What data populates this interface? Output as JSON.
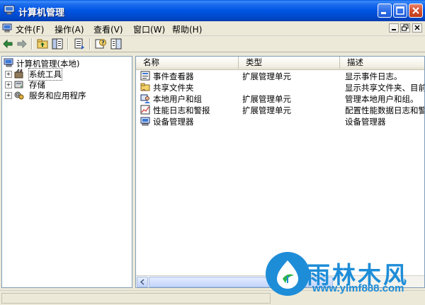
{
  "window": {
    "title": "计算机管理"
  },
  "menu": {
    "items": [
      "文件(F)",
      "操作(A)",
      "查看(V)",
      "窗口(W)",
      "帮助(H)"
    ]
  },
  "toolbar": {
    "icons": [
      "back-arrow-icon",
      "forward-arrow-icon",
      "up-folder-icon",
      "show-hide-tree-icon",
      "export-list-icon",
      "help-icon",
      "properties-icon"
    ]
  },
  "tree": {
    "root": "计算机管理(本地)",
    "children": [
      "系统工具",
      "存储",
      "服务和应用程序"
    ]
  },
  "list": {
    "columns": [
      "名称",
      "类型",
      "描述"
    ],
    "rows": [
      {
        "name": "事件查看器",
        "type": "扩展管理单元",
        "desc": "显示事件日志。"
      },
      {
        "name": "共享文件夹",
        "type": "",
        "desc": "显示共享文件夹、目前"
      },
      {
        "name": "本地用户和组",
        "type": "扩展管理单元",
        "desc": "管理本地用户和组。"
      },
      {
        "name": "性能日志和警报",
        "type": "扩展管理单元",
        "desc": "配置性能数据日志和警"
      },
      {
        "name": "设备管理器",
        "type": "",
        "desc": "设备管理器"
      }
    ]
  },
  "watermark": {
    "text": "雨林木风",
    "url": "www.ylmf888.com"
  },
  "colors": {
    "title_bar": "#0054E3",
    "selection": "#316AC5",
    "watermark": "#1E8DD8"
  }
}
